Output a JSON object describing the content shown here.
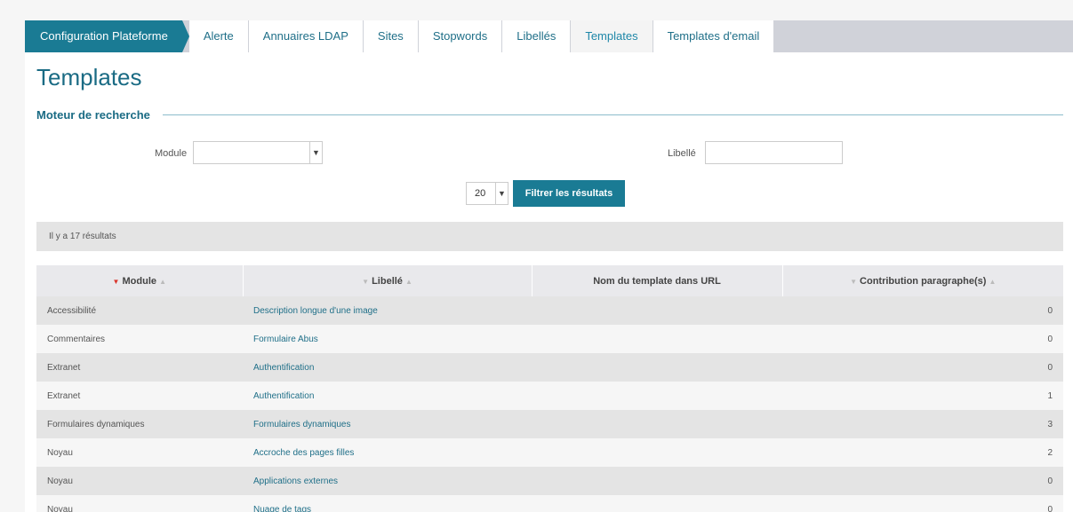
{
  "tabs": [
    {
      "label": "Configuration Plateforme"
    },
    {
      "label": "Alerte"
    },
    {
      "label": "Annuaires LDAP"
    },
    {
      "label": "Sites"
    },
    {
      "label": "Stopwords"
    },
    {
      "label": "Libellés"
    },
    {
      "label": "Templates"
    },
    {
      "label": "Templates d'email"
    }
  ],
  "page_title": "Templates",
  "search": {
    "section_title": "Moteur de recherche",
    "module_label": "Module",
    "module_value": "",
    "libelle_label": "Libellé",
    "libelle_value": "",
    "page_size": "20",
    "filter_button": "Filtrer les résultats"
  },
  "results": {
    "count_text": "Il y a 17 résultats",
    "columns": [
      "Module",
      "Libellé",
      "Nom du template dans URL",
      "Contribution paragraphe(s)"
    ],
    "sort_icons": {
      "down": "▼",
      "up": "▲"
    },
    "rows": [
      {
        "module": "Accessibilité",
        "libelle": "Description longue d'une image",
        "url": "",
        "contrib": "0"
      },
      {
        "module": "Commentaires",
        "libelle": "Formulaire Abus",
        "url": "",
        "contrib": "0"
      },
      {
        "module": "Extranet",
        "libelle": "Authentification",
        "url": "",
        "contrib": "0"
      },
      {
        "module": "Extranet",
        "libelle": "Authentification",
        "url": "",
        "contrib": "1"
      },
      {
        "module": "Formulaires dynamiques",
        "libelle": "Formulaires dynamiques",
        "url": "",
        "contrib": "3"
      },
      {
        "module": "Noyau",
        "libelle": "Accroche des pages filles",
        "url": "",
        "contrib": "2"
      },
      {
        "module": "Noyau",
        "libelle": "Applications externes",
        "url": "",
        "contrib": "0"
      },
      {
        "module": "Noyau",
        "libelle": "Nuage de tags",
        "url": "",
        "contrib": "0"
      }
    ]
  },
  "colors": {
    "brand": "#1a7b94",
    "title": "#1a6b84",
    "tab_bar": "#d0d2d9"
  }
}
